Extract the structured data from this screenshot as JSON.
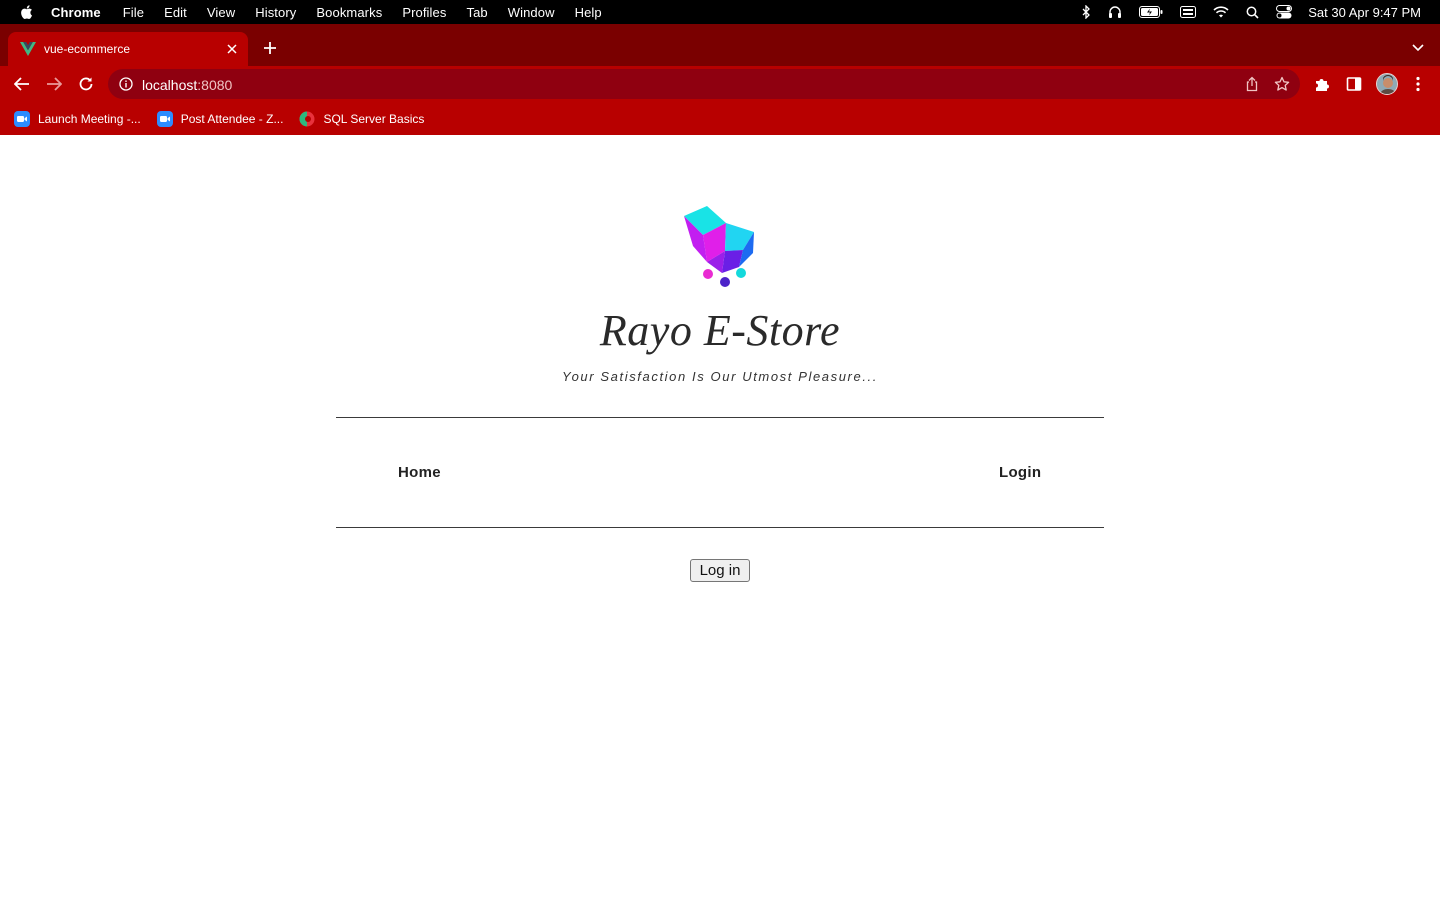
{
  "menubar": {
    "app_name": "Chrome",
    "items": [
      "File",
      "Edit",
      "View",
      "History",
      "Bookmarks",
      "Profiles",
      "Tab",
      "Window",
      "Help"
    ],
    "clock": "Sat 30 Apr  9:47 PM"
  },
  "browser": {
    "tab_title": "vue-ecommerce",
    "url_host": "localhost",
    "url_port": ":8080",
    "theme_color": "#b80000",
    "bookmarks": [
      {
        "label": "Launch Meeting -...",
        "icon": "zoom-icon"
      },
      {
        "label": "Post Attendee - Z...",
        "icon": "zoom-icon"
      },
      {
        "label": "SQL Server Basics",
        "icon": "circle-logo-icon"
      }
    ]
  },
  "page": {
    "brand": "Rayo E-Store",
    "tagline": "Your Satisfaction Is Our Utmost Pleasure...",
    "nav": {
      "home": "Home",
      "login": "Login"
    },
    "login_button": "Log in"
  }
}
